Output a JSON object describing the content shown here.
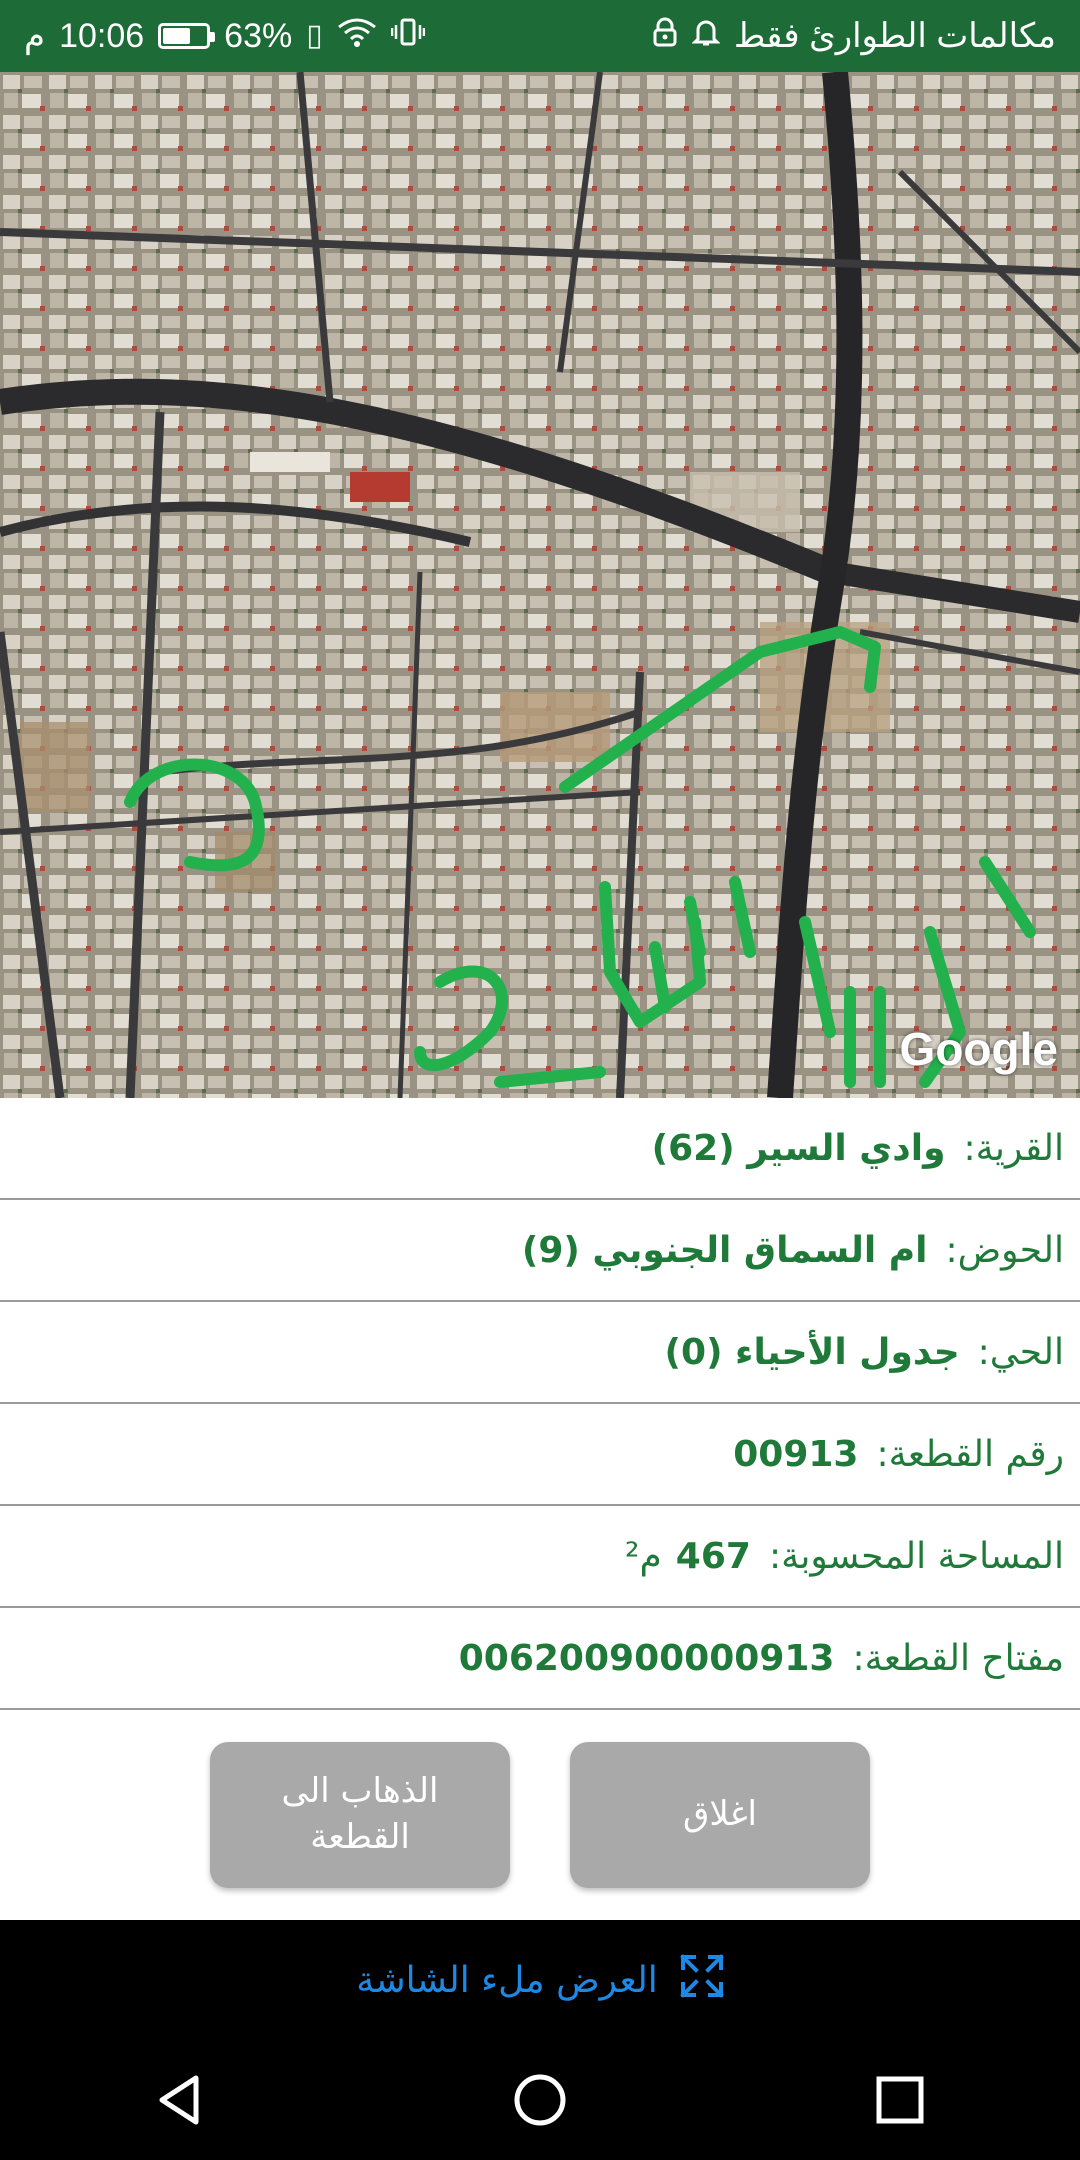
{
  "status_bar": {
    "time": "10:06",
    "time_suffix": "م",
    "battery_percent": "63%",
    "battery_level": 0.63,
    "carrier_text": "مكالمات الطوارئ فقط",
    "icons": [
      "sim-icon",
      "wifi-icon",
      "vibrate-icon",
      "lock-icon",
      "bell-icon"
    ]
  },
  "map": {
    "attribution": "Google",
    "annotation_color": "#22b14c"
  },
  "parcel_info": {
    "rows": [
      {
        "label": "القرية:",
        "value": "وادي السير (62)",
        "unit": ""
      },
      {
        "label": "الحوض:",
        "value": "ام السماق الجنوبي (9)",
        "unit": ""
      },
      {
        "label": "الحي:",
        "value": "جدول الأحياء (0)",
        "unit": ""
      },
      {
        "label": "رقم القطعة:",
        "value": "00913",
        "unit": ""
      },
      {
        "label": "المساحة المحسوبة:",
        "value": "467",
        "unit": "م²"
      },
      {
        "label": "مفتاح القطعة:",
        "value": "006200900000913",
        "unit": ""
      }
    ]
  },
  "buttons": {
    "goto_label": "الذهاب الى القطعة",
    "close_label": "اغلاق"
  },
  "fullscreen": {
    "label": "العرض ملء الشاشة",
    "icon": "expand-icon"
  },
  "navigation": {
    "icons": [
      "back-icon",
      "home-icon",
      "recents-icon"
    ]
  },
  "colors": {
    "status_bar": "#1d6b37",
    "text_green": "#1f7a3a",
    "button_gray": "#a9a9a9",
    "link_blue": "#1e88e5"
  }
}
